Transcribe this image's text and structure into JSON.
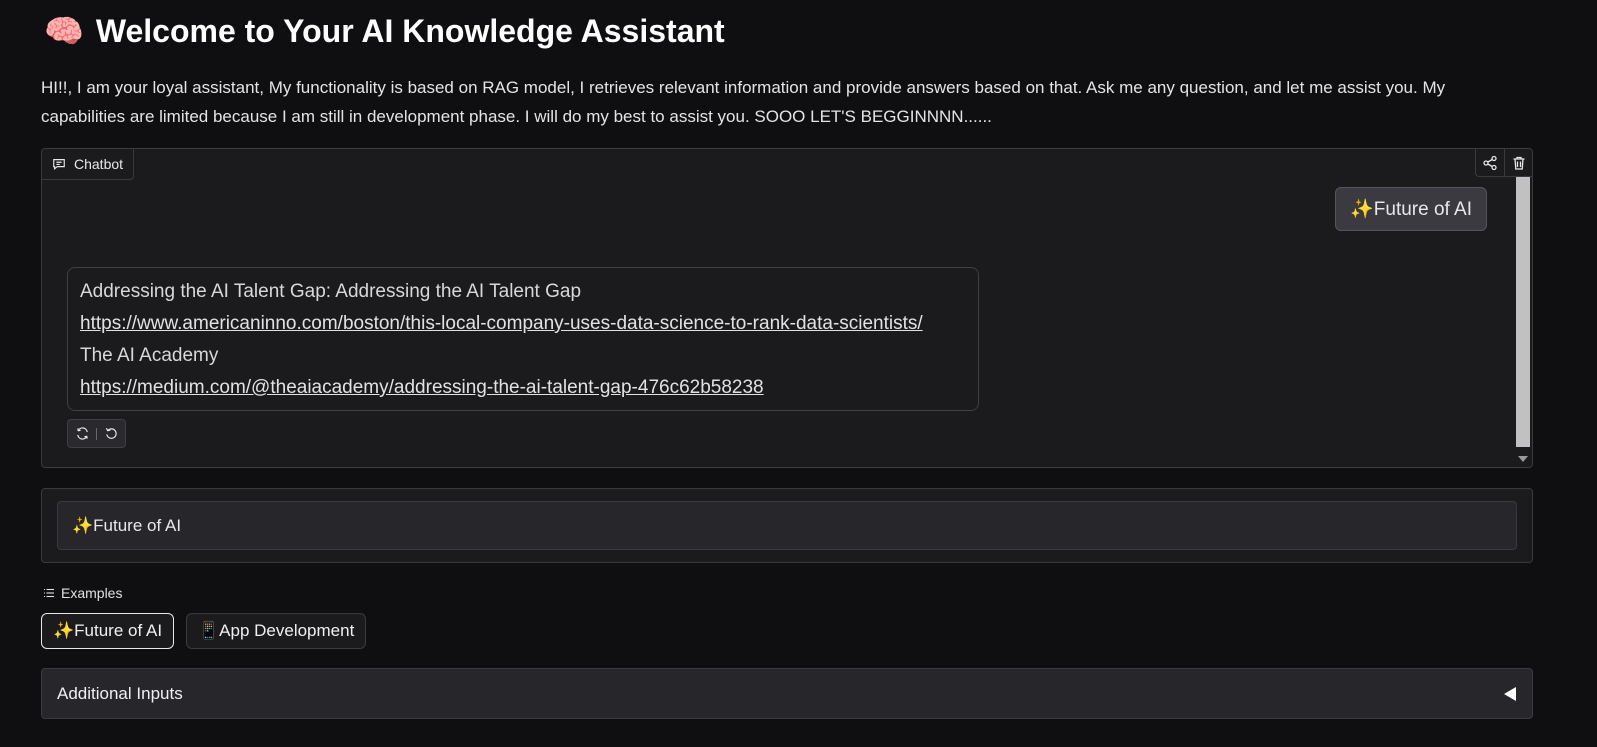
{
  "header": {
    "emoji": "🧠",
    "title": "Welcome to Your AI Knowledge Assistant",
    "description": "HI!!, I am your loyal assistant, My functionality is based on RAG model, I retrieves relevant information and provide answers based on that. Ask me any question, and let me assist you. My capabilities are limited because I am still in development phase. I will do my best to assist you. SOOO LET'S BEGGINNNN......"
  },
  "chatbot": {
    "label": "Chatbot",
    "user_message": "✨Future of AI",
    "bot_message": {
      "lines": [
        {
          "text": "Addressing the AI Talent Gap: Addressing the AI Talent Gap",
          "link": false
        },
        {
          "text": "https://www.americaninno.com/boston/this-local-company-uses-data-science-to-rank-data-scientists/",
          "link": true
        },
        {
          "text": "The AI Academy",
          "link": false
        },
        {
          "text": "https://medium.com/@theaiacademy/addressing-the-ai-talent-gap-476c62b58238",
          "link": true
        }
      ]
    },
    "icons": {
      "label": "chat-bubble-icon",
      "share": "share-icon",
      "delete": "trash-icon",
      "retry": "retry-icon",
      "undo": "undo-icon"
    }
  },
  "input": {
    "value": "✨Future of AI"
  },
  "examples": {
    "label": "Examples",
    "items": [
      {
        "label": "✨Future of AI",
        "active": true
      },
      {
        "label": "📱App Development",
        "active": false
      }
    ]
  },
  "additional_inputs": {
    "label": "Additional Inputs"
  },
  "colors": {
    "background": "#0f0f11",
    "panel": "#1b1b1e",
    "border": "#3a3a3f",
    "user_bubble": "#3a3a40",
    "scrollbar_thumb": "#c1c1c1"
  }
}
